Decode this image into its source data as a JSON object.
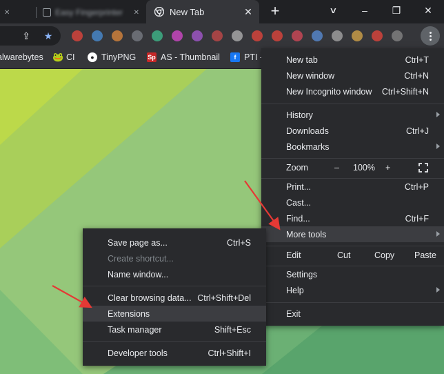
{
  "tabs": {
    "inactive": [
      {
        "label": "Easy Fingerprinter"
      }
    ],
    "active": {
      "label": "New Tab"
    }
  },
  "window_controls": {
    "minimize": "–",
    "maximize": "❐",
    "close": "✕",
    "dropdown": "⌄"
  },
  "bookmarks": [
    {
      "label": "alwarebytes",
      "icon": "malwarebytes-icon"
    },
    {
      "label": "CI",
      "icon": "frog-icon"
    },
    {
      "label": "TinyPNG",
      "icon": "panda-icon"
    },
    {
      "label": "AS - Thumbnail",
      "icon": "sp-icon",
      "icon_text": "Sp"
    },
    {
      "label": "PTI -",
      "icon": "facebook-icon",
      "icon_text": "f"
    }
  ],
  "extension_colors": [
    "#e8453c",
    "#4a90d9",
    "#e08a3c",
    "#7b7f87",
    "#3fbf8f",
    "#d94ad0",
    "#a95ad6",
    "#c94a4a",
    "#b4b4b4",
    "#e8453c",
    "#e8453c",
    "#d94a5a",
    "#5a8fd9",
    "#aaaaaa",
    "#d9a84a",
    "#e8453c",
    "#888888"
  ],
  "main_menu": {
    "items": [
      {
        "label": "New tab",
        "shortcut": "Ctrl+T"
      },
      {
        "label": "New window",
        "shortcut": "Ctrl+N"
      },
      {
        "label": "New Incognito window",
        "shortcut": "Ctrl+Shift+N"
      },
      {
        "label": "History",
        "shortcut": ""
      },
      {
        "label": "Downloads",
        "shortcut": "Ctrl+J"
      },
      {
        "label": "Bookmarks",
        "shortcut": ""
      },
      {
        "label": "Print...",
        "shortcut": "Ctrl+P"
      },
      {
        "label": "Cast...",
        "shortcut": ""
      },
      {
        "label": "Find...",
        "shortcut": "Ctrl+F"
      },
      {
        "label": "More tools",
        "shortcut": ""
      },
      {
        "label": "Settings",
        "shortcut": ""
      },
      {
        "label": "Help",
        "shortcut": ""
      },
      {
        "label": "Exit",
        "shortcut": ""
      }
    ],
    "zoom": {
      "label": "Zoom",
      "minus": "–",
      "value": "100%",
      "plus": "+"
    },
    "edit": {
      "label": "Edit",
      "cut": "Cut",
      "copy": "Copy",
      "paste": "Paste"
    }
  },
  "more_tools_menu": {
    "items": [
      {
        "label": "Save page as...",
        "shortcut": "Ctrl+S"
      },
      {
        "label": "Create shortcut...",
        "shortcut": ""
      },
      {
        "label": "Name window...",
        "shortcut": ""
      },
      {
        "label": "Clear browsing data...",
        "shortcut": "Ctrl+Shift+Del"
      },
      {
        "label": "Extensions",
        "shortcut": ""
      },
      {
        "label": "Task manager",
        "shortcut": "Shift+Esc"
      },
      {
        "label": "Developer tools",
        "shortcut": "Ctrl+Shift+I"
      }
    ]
  },
  "colors": {
    "accent": "#e8eaed",
    "menu_bg": "#292a2d",
    "highlight": "#3c3d41",
    "annotation_arrow": "#e53935"
  }
}
